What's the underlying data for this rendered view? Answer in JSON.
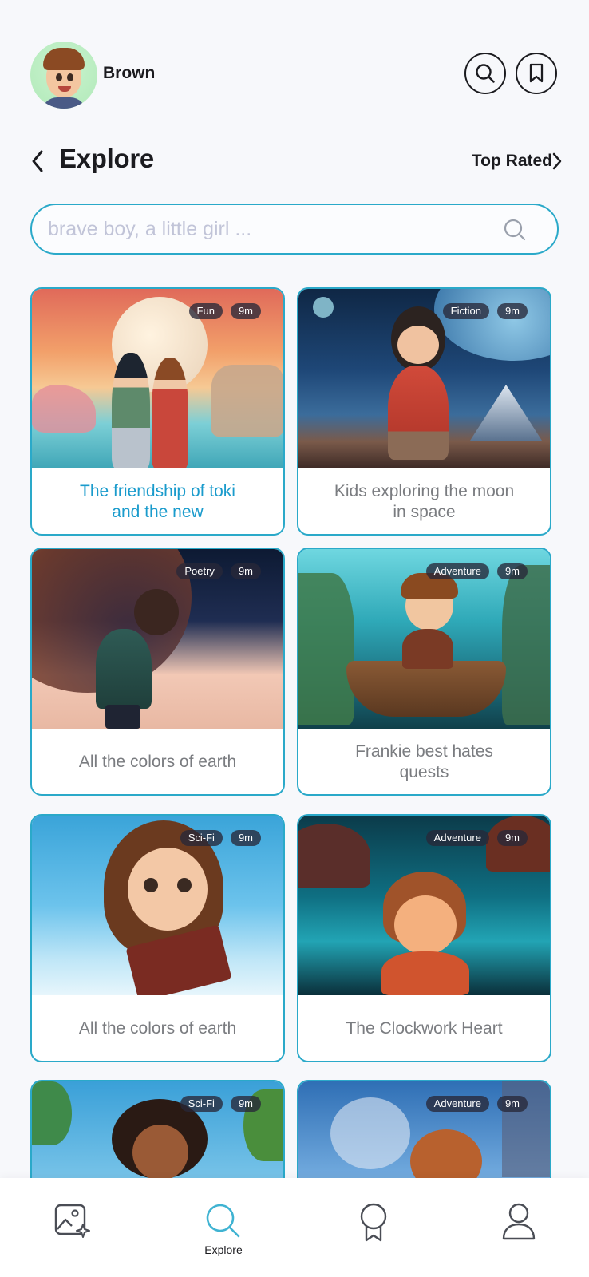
{
  "header": {
    "username": "Brown"
  },
  "page": {
    "title": "Explore",
    "top_rated_label": "Top Rated"
  },
  "search": {
    "placeholder": "brave boy, a little girl ..."
  },
  "stories": [
    {
      "title": "The friendship of toki and the new",
      "genre": "Fun",
      "duration": "9m",
      "active": true
    },
    {
      "title": "Kids exploring the moon in space",
      "genre": "Fiction",
      "duration": "9m",
      "active": false
    },
    {
      "title": "All the colors of earth",
      "genre": "Poetry",
      "duration": "9m",
      "active": false
    },
    {
      "title": "Frankie best hates quests",
      "genre": "Adventure",
      "duration": "9m",
      "active": false
    },
    {
      "title": "All the colors of earth",
      "genre": "Sci-Fi",
      "duration": "9m",
      "active": false
    },
    {
      "title": "The Clockwork Heart",
      "genre": "Adventure",
      "duration": "9m",
      "active": false
    },
    {
      "title": "",
      "genre": "Sci-Fi",
      "duration": "9m",
      "active": false
    },
    {
      "title": "",
      "genre": "Adventure",
      "duration": "9m",
      "active": false
    }
  ],
  "bottom_nav": {
    "items": [
      {
        "icon": "gallery-sparkle-icon",
        "label": ""
      },
      {
        "icon": "search-icon",
        "label": "Explore",
        "active": true
      },
      {
        "icon": "award-badge-icon",
        "label": ""
      },
      {
        "icon": "profile-icon",
        "label": ""
      }
    ]
  },
  "colors": {
    "accent": "#2aa9c9",
    "active_title": "#1a9bcc",
    "background": "#f7f8fb",
    "tag_bg": "#2a2a38"
  }
}
